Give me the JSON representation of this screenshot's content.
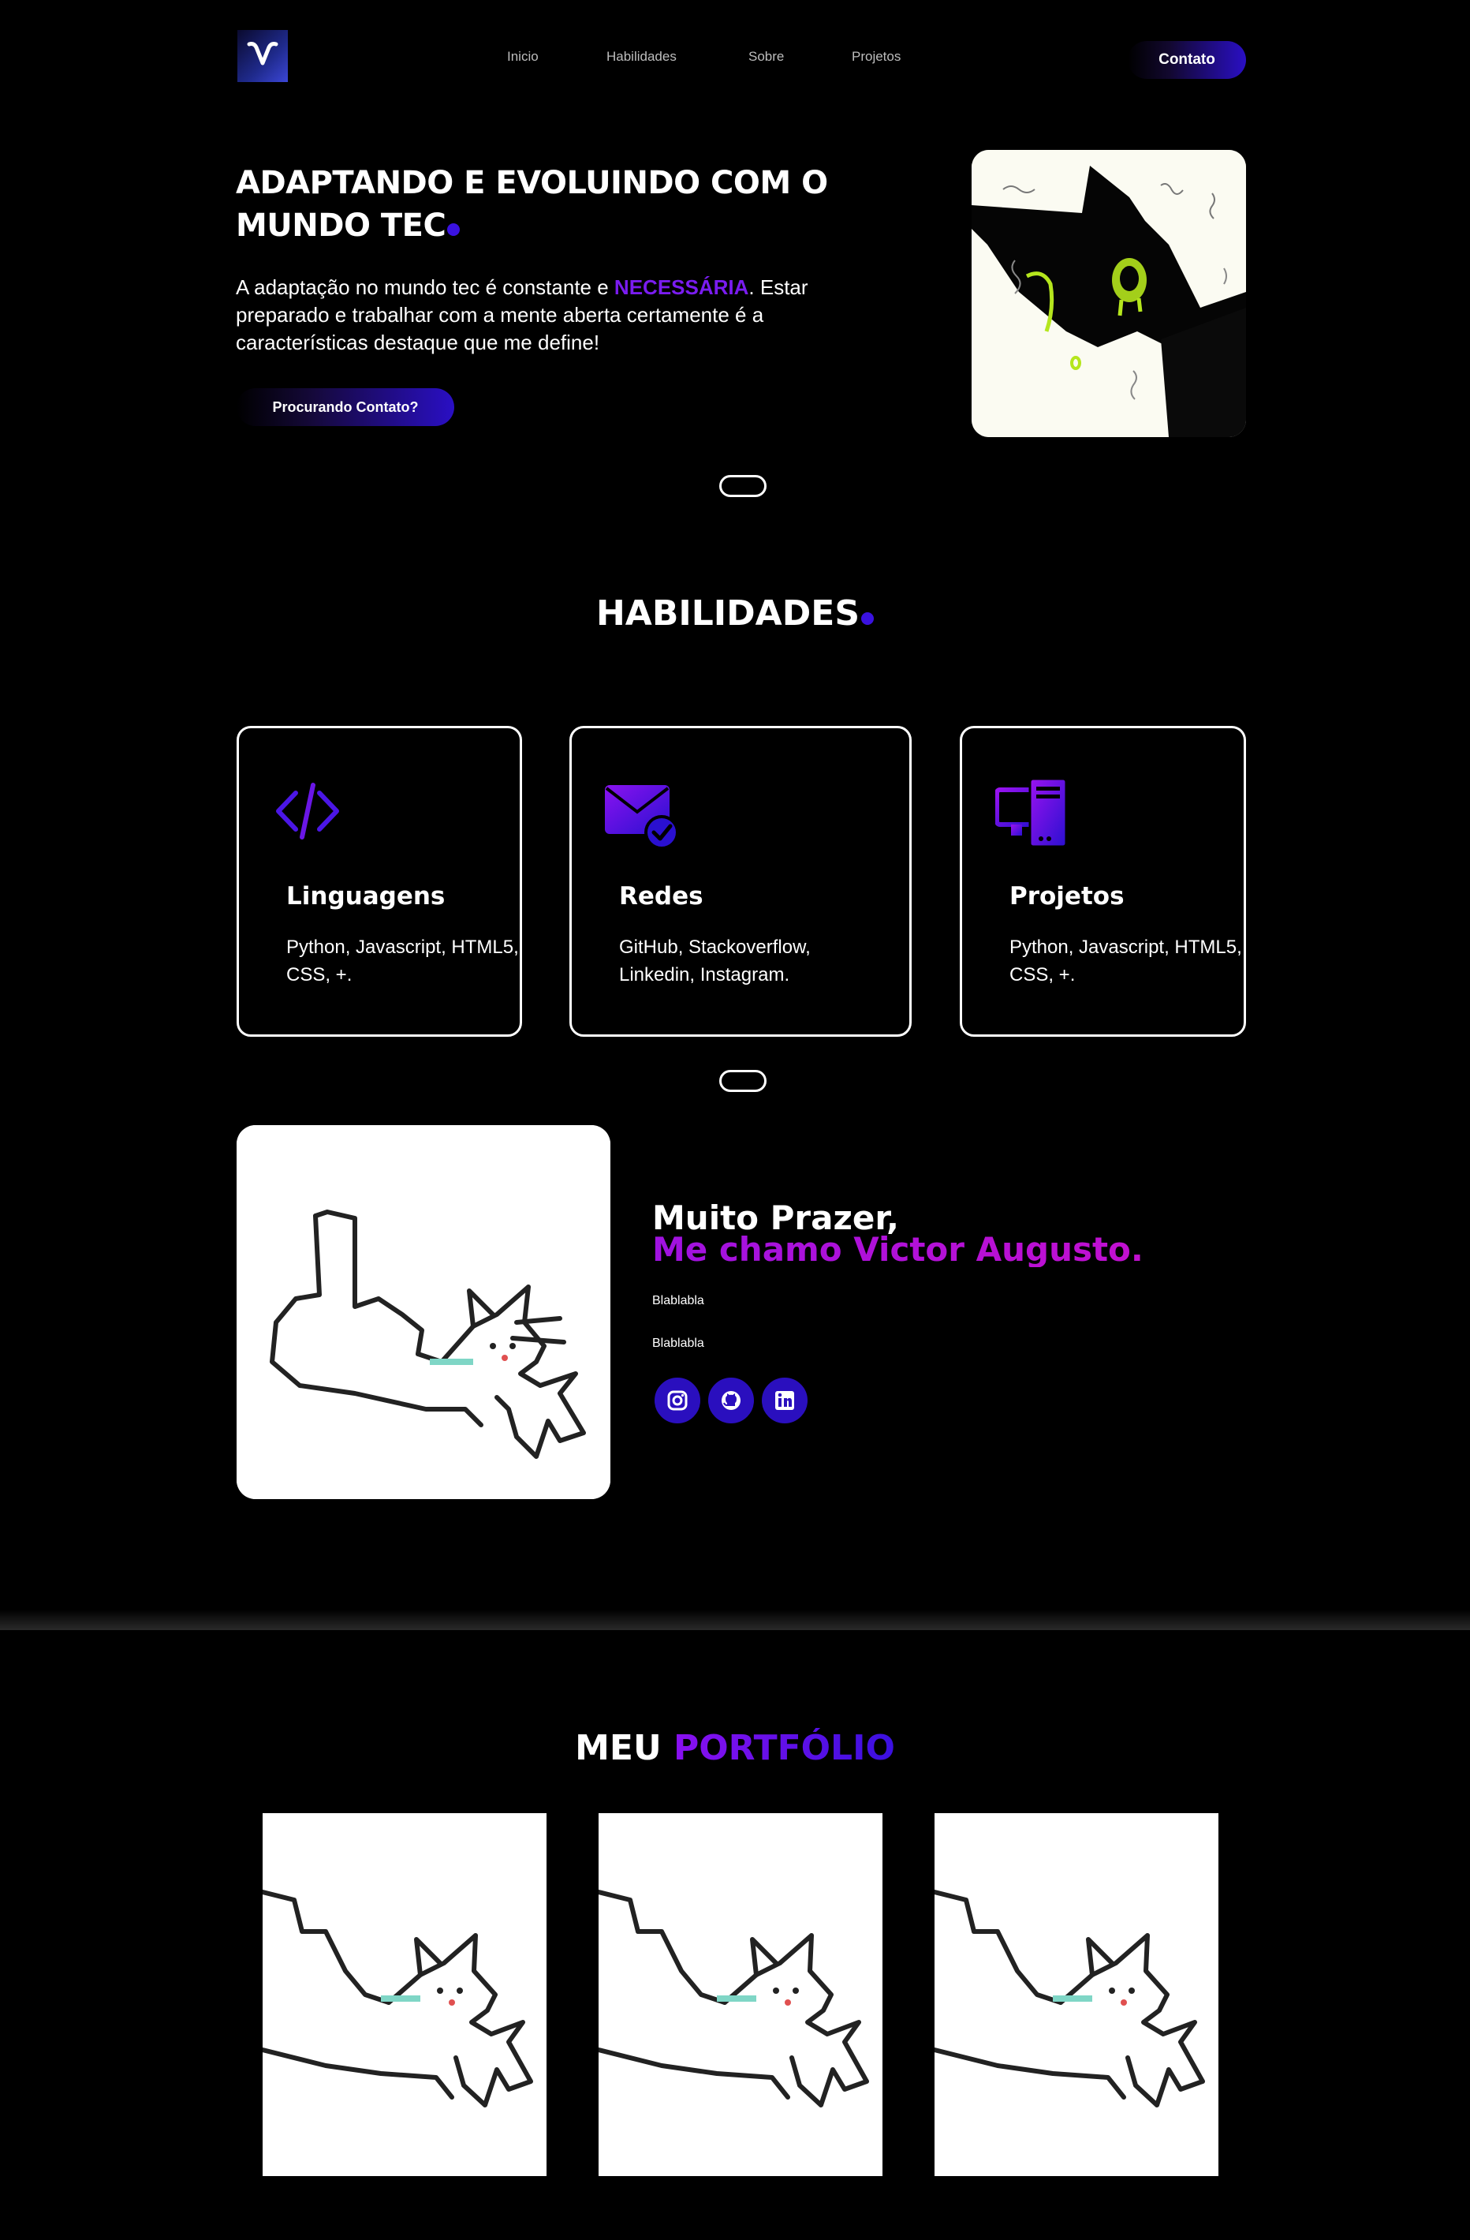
{
  "nav": {
    "links": [
      "Inicio",
      "Habilidades",
      "Sobre",
      "Projetos"
    ],
    "contact_label": "Contato"
  },
  "hero": {
    "title": "ADAPTANDO E EVOLUINDO COM O MUNDO TEC",
    "text_before": "A adaptação no mundo tec é constante e ",
    "text_accent": "NECESSÁRIA",
    "text_after": ". Estar preparado e trabalhar com a mente aberta certamente é a características destaque que me define!",
    "button_label": "Procurando Contato?"
  },
  "skills": {
    "title": "HABILIDADES",
    "cards": [
      {
        "icon": "code-icon",
        "title": "Linguagens",
        "text": "Python, Javascript, HTML5, CSS, +."
      },
      {
        "icon": "mail-check-icon",
        "title": "Redes",
        "text": "GitHub, Stackoverflow, Linkedin, Instagram."
      },
      {
        "icon": "computer-icon",
        "title": "Projetos",
        "text": "Python, Javascript, HTML5, CSS, +."
      }
    ]
  },
  "about": {
    "greeting": "Muito Prazer,",
    "name_line": "Me chamo Victor Augusto.",
    "para1": "Blablabla",
    "para2": "Blablabla",
    "socials": [
      "instagram-icon",
      "github-icon",
      "linkedin-icon"
    ]
  },
  "portfolio": {
    "title_white": "MEU ",
    "title_accent": "PORTFÓLIO"
  },
  "colors": {
    "accent_blue": "#2a0fc4",
    "accent_purple": "#7a1cf0",
    "background": "#000000"
  }
}
